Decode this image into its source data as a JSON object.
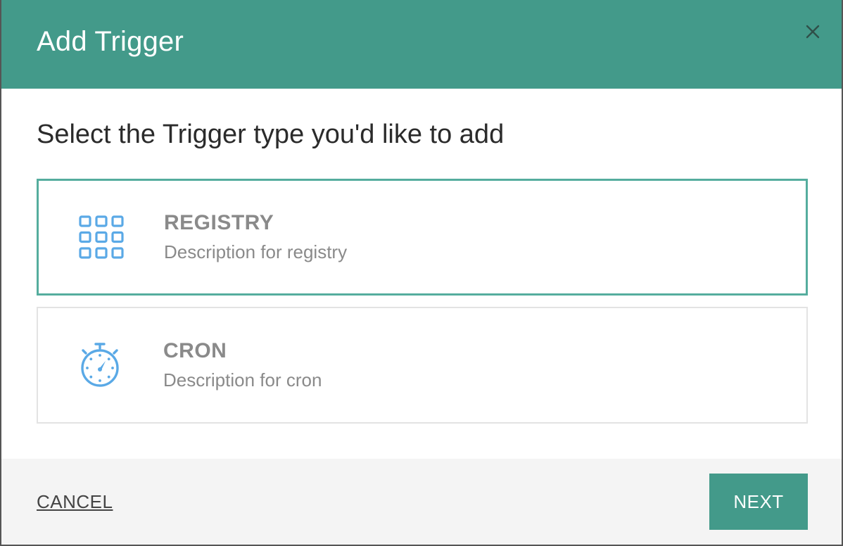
{
  "dialog": {
    "title": "Add Trigger",
    "close_icon": "close-icon",
    "header_color": "#439a8a"
  },
  "body": {
    "prompt": "Select the Trigger type you'd like to add",
    "options": [
      {
        "name": "REGISTRY",
        "description": "Description for registry",
        "icon": "grid-icon",
        "selected": true
      },
      {
        "name": "CRON",
        "description": "Description for cron",
        "icon": "stopwatch-icon",
        "selected": false
      }
    ]
  },
  "footer": {
    "cancel_label": "CANCEL",
    "next_label": "NEXT"
  },
  "colors": {
    "accent": "#439a8a",
    "selected_border": "#55ad9e",
    "icon": "#5aa9e6"
  }
}
